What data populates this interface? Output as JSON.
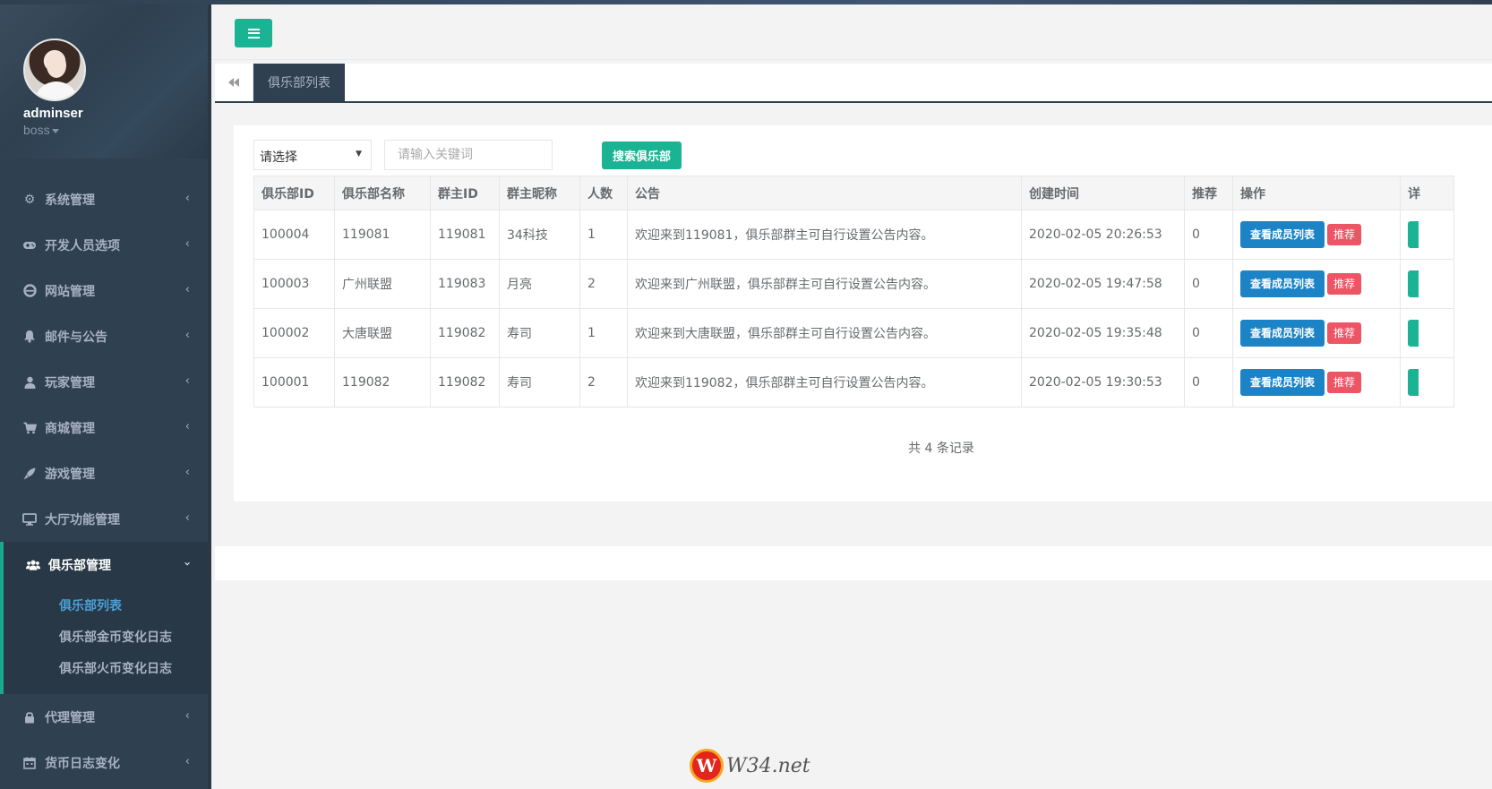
{
  "profile": {
    "name": "adminser",
    "role": "boss"
  },
  "sidebar": {
    "items": [
      {
        "label": "系统管理",
        "icon": "gears-icon"
      },
      {
        "label": "开发人员选项",
        "icon": "gamepad-icon"
      },
      {
        "label": "网站管理",
        "icon": "internet-explorer-icon"
      },
      {
        "label": "邮件与公告",
        "icon": "bell-icon"
      },
      {
        "label": "玩家管理",
        "icon": "user-icon"
      },
      {
        "label": "商城管理",
        "icon": "cart-icon"
      },
      {
        "label": "游戏管理",
        "icon": "rocket-icon"
      },
      {
        "label": "大厅功能管理",
        "icon": "desktop-icon"
      },
      {
        "label": "俱乐部管理",
        "icon": "users-icon"
      }
    ],
    "club_submenu": [
      {
        "label": "俱乐部列表"
      },
      {
        "label": "俱乐部金币变化日志"
      },
      {
        "label": "俱乐部火币变化日志"
      }
    ],
    "items_after": [
      {
        "label": "代理管理",
        "icon": "lock-icon"
      },
      {
        "label": "货币日志变化",
        "icon": "calendar-icon"
      }
    ]
  },
  "tabs": {
    "active_label": "俱乐部列表"
  },
  "filters": {
    "select_value": "请选择",
    "search_placeholder": "请输入关键词",
    "search_button": "搜索俱乐部"
  },
  "table": {
    "headers": [
      "俱乐部ID",
      "俱乐部名称",
      "群主ID",
      "群主昵称",
      "人数",
      "公告",
      "创建时间",
      "推荐",
      "操作",
      "详"
    ],
    "rows": [
      {
        "id": "100004",
        "name": "119081",
        "owner_id": "119081",
        "owner_nick": "34科技",
        "members": "1",
        "notice": "欢迎来到119081，俱乐部群主可自行设置公告内容。",
        "created": "2020-02-05 20:26:53",
        "recommend": "0"
      },
      {
        "id": "100003",
        "name": "广州联盟",
        "owner_id": "119083",
        "owner_nick": "月亮",
        "members": "2",
        "notice": "欢迎来到广州联盟，俱乐部群主可自行设置公告内容。",
        "created": "2020-02-05 19:47:58",
        "recommend": "0"
      },
      {
        "id": "100002",
        "name": "大唐联盟",
        "owner_id": "119082",
        "owner_nick": "寿司",
        "members": "1",
        "notice": "欢迎来到大唐联盟，俱乐部群主可自行设置公告内容。",
        "created": "2020-02-05 19:35:48",
        "recommend": "0"
      },
      {
        "id": "100001",
        "name": "119082",
        "owner_id": "119082",
        "owner_nick": "寿司",
        "members": "2",
        "notice": "欢迎来到119082，俱乐部群主可自行设置公告内容。",
        "created": "2020-02-05 19:30:53",
        "recommend": "0"
      }
    ],
    "action_view": "查看成员列表",
    "action_recommend": "推荐"
  },
  "pagination": {
    "summary": "共 4 条记录"
  },
  "watermark": {
    "logo_letter": "W",
    "text": "W34.net"
  },
  "colors": {
    "sidebar_bg": "#2f4050",
    "accent_green": "#1ab394",
    "button_blue": "#1c84c6",
    "button_red": "#ed5565",
    "active_link": "#4a9fd8"
  }
}
